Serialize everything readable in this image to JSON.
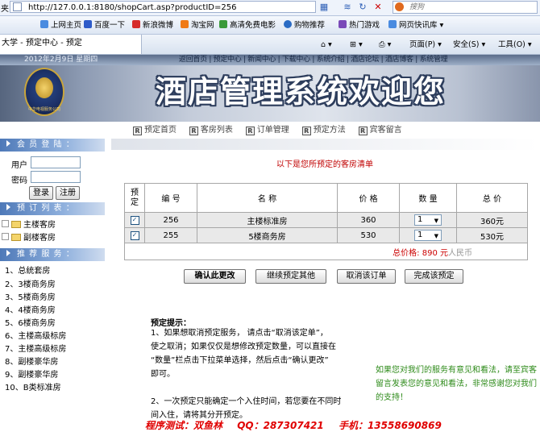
{
  "browser": {
    "address": "http://127.0.0.1:8180/shopCart.asp?productID=256",
    "search_placeholder": "搜狗",
    "left_partial": "夹",
    "favorites": [
      "上网主页",
      "百度一下",
      "新浪微博",
      "淘宝网",
      "高清免费电影",
      "购物推荐",
      "热门游戏",
      "网页快讯库"
    ],
    "tab_title": "大学 - 预定中心 - 预定",
    "commands": [
      "页面(P)",
      "安全(S)",
      "工具(O)"
    ],
    "colors": {
      "accent": "#2b5db5"
    }
  },
  "header": {
    "date": "2012年2月9日  星期四",
    "nav": "返回首页 | 预定中心 | 新闻中心 | 下载中心 | 系统介绍 | 酒店论坛 | 酒店博客 | 系统管理",
    "title": "酒店管理系统欢迎您",
    "logo_text": "中华电视服务公司"
  },
  "sidebar": {
    "login_title": "会 员 登 陆 ：",
    "user_label": "用户",
    "password_label": "密码",
    "login_button": "登录",
    "register_button": "注册",
    "booking_title": "预 订 列 表 ：",
    "booking_items": [
      "主楼客房",
      "副楼客房"
    ],
    "recommend_title": "推 荐 服 务 ：",
    "recommend_items": [
      "1、总统套房",
      "2、3楼商务房",
      "3、5楼商务房",
      "4、4楼商务房",
      "5、6楼商务房",
      "6、主楼高级标房",
      "7、主楼高级标房",
      "8、副楼豪华房",
      "9、副楼豪华房",
      "10、B类标准房"
    ]
  },
  "subnav": [
    "预定首页",
    "客房列表",
    "订单管理",
    "预定方法",
    "宾客留言"
  ],
  "main": {
    "caption": "以下是您所预定的客房清单",
    "columns": [
      "预定",
      "编 号",
      "名 称",
      "价 格",
      "数 量",
      "总 价"
    ],
    "rows": [
      {
        "id": "256",
        "name": "主楼标准房",
        "price": "360",
        "qty": "1",
        "total": "360元"
      },
      {
        "id": "255",
        "name": "5楼商务房",
        "price": "530",
        "qty": "1",
        "total": "530元"
      }
    ],
    "total_label": "总价格: ",
    "total_value": "890",
    "total_unit": "元",
    "total_currency": "人民币",
    "buttons": [
      "确认此更改",
      "继续预定其他",
      "取消该订单",
      "完成该预定"
    ]
  },
  "tips": {
    "title": "预定提示：",
    "lines": [
      "1、如果想取消预定服务，  请点击“取消该定单”，",
      "使之取消；如果仅仅是想修改预定数量，可以直接在",
      "“数量”栏点击下拉菜单选择，然后点击“确认更改”",
      "即可。",
      "",
      "2、一次预定只能确定一个入住时间，若您要在不同时",
      "间入住，请将其分开预定。"
    ]
  },
  "contact": "如果您对我们的服务有意见和看法，请至宾客留言发表您的意见和看法，非常感谢您对我们的支持！",
  "footer": {
    "tester": "程序测试：双鱼林",
    "qq": "QQ：287307421",
    "phone": "手机：13558690869"
  }
}
